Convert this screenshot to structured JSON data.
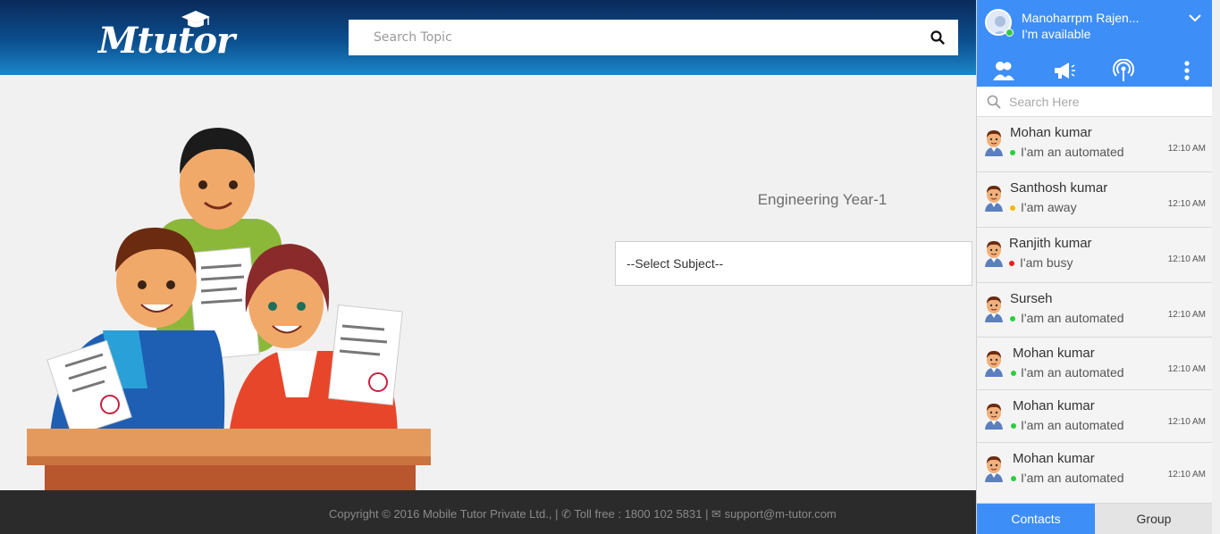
{
  "header": {
    "logo_text": "Mtutor",
    "search_placeholder": "Search Topic"
  },
  "main": {
    "heading": "Engineering Year-1",
    "subject_select": "--Select Subject--"
  },
  "footer": {
    "copyright": "Copyright © 2016 Mobile Tutor Private Ltd., | ✆ Toll free : 1800 102 5831 | ✉ support@m-tutor.com"
  },
  "chat": {
    "user_name": "Manoharrpm Rajen...",
    "user_status": "I'm available",
    "search_placeholder": "Search Here",
    "contacts": [
      {
        "name": "Mohan kumar",
        "status": "I'am an automated",
        "time": "12:10 AM",
        "status_color": "#2ecc40"
      },
      {
        "name": "Santhosh kumar",
        "status": "I'am away",
        "time": "12:10 AM",
        "status_color": "#f5b800"
      },
      {
        "name": "Ranjith kumar",
        "status": "I'am busy",
        "time": "12:10 AM",
        "status_color": "#e0221b"
      },
      {
        "name": "Surseh",
        "status": "I'am an automated",
        "time": "12:10 AM",
        "status_color": "#2ecc40"
      },
      {
        "name": "Mohan kumar",
        "status": "I'am an automated",
        "time": "12:10 AM",
        "status_color": "#2ecc40"
      },
      {
        "name": "Mohan kumar",
        "status": "I'am an automated",
        "time": "12:10 AM",
        "status_color": "#2ecc40"
      },
      {
        "name": "Mohan kumar",
        "status": "I'am an automated",
        "time": "12:10 AM",
        "status_color": "#2ecc40"
      }
    ],
    "tabs": {
      "contacts": "Contacts",
      "group": "Group"
    }
  },
  "colors": {
    "accent": "#3e8ef7",
    "header_dark": "#0a2a5a",
    "footer": "#2b2b2b"
  },
  "icons": [
    "search-icon",
    "contacts-icon",
    "megaphone-icon",
    "broadcast-icon",
    "more-vertical-icon",
    "chevron-down-icon"
  ]
}
